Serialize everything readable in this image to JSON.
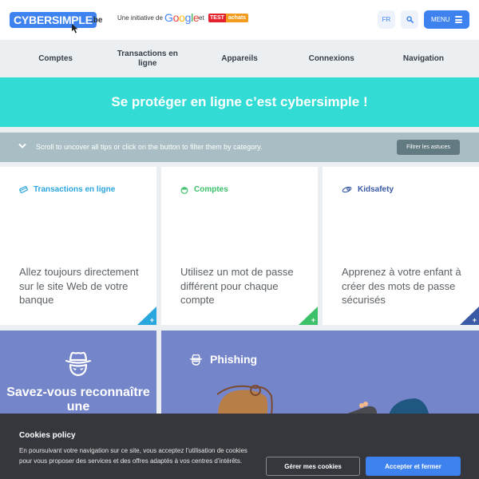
{
  "header": {
    "logo_text": "CYBERSIMPLE",
    "logo_tld": ".be",
    "initiative_text": "Une initiative de",
    "google_letters": [
      "G",
      "o",
      "o",
      "g",
      "l",
      "e"
    ],
    "and_text": "et",
    "partner_test": "TEST",
    "partner_achats": "achats",
    "lang_button": "FR",
    "menu_button": "MENU"
  },
  "nav": {
    "items": [
      {
        "label": "Comptes"
      },
      {
        "label": "Transactions en ligne"
      },
      {
        "label": "Appareils"
      },
      {
        "label": "Connexions"
      },
      {
        "label": "Navigation"
      }
    ]
  },
  "hero": {
    "title": "Se protéger en ligne c’est cybersimple !"
  },
  "filter": {
    "hint": "Scroll to uncover all tips or click on the button to filter them by category.",
    "button": "Filtrer les astuces"
  },
  "cards": [
    {
      "category": "Transactions en ligne",
      "icon": "credit-card-icon",
      "color": "#2aa6de",
      "text": "Allez toujours directement sur le site Web de votre banque",
      "more": "+"
    },
    {
      "category": "Comptes",
      "icon": "user-face-icon",
      "color": "#3cc06a",
      "text": "Utilisez un mot de passe différent pour chaque compte",
      "more": "+"
    },
    {
      "category": "Kidsafety",
      "icon": "pacifier-icon",
      "color": "#3a5aa5",
      "text": "Apprenez à votre enfant à créer des mots de passe sécurisés",
      "more": "+"
    }
  ],
  "panels": {
    "left_title": "Savez-vous reconnaître une",
    "right_title": "Phishing"
  },
  "cookie": {
    "title": "Cookies policy",
    "text": "En poursuivant votre navigation sur ce site, vous acceptez l’utilisation de cookies pour vous proposer des services et des offres adaptés à vos centres d’intérêts.",
    "manage_button": "Gérer mes cookies",
    "accept_button": "Accepter et fermer"
  },
  "colors": {
    "brand": "#3d82ee",
    "hero": "#32dbd3",
    "filterbar": "#a8bec4",
    "panel": "#7585ca",
    "cookie_bg": "#36373c"
  }
}
